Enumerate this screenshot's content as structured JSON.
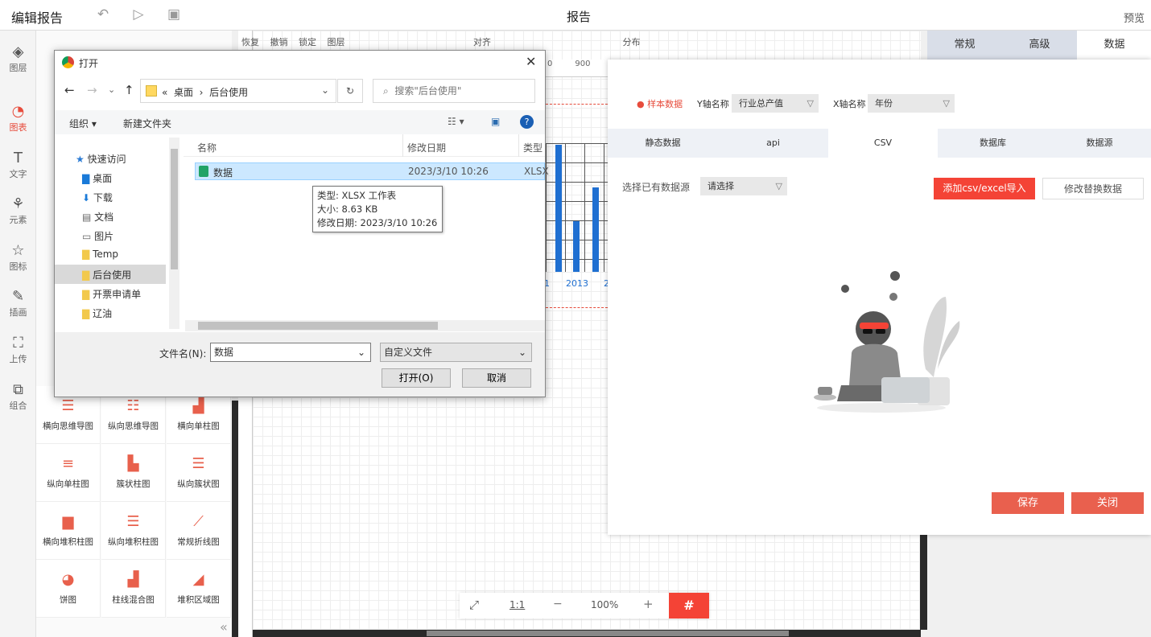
{
  "topbar": {
    "title": "编辑报告",
    "center_title": "报告",
    "preview": "预览"
  },
  "leftnav": [
    {
      "label": "图层",
      "icon": "layers-icon"
    },
    {
      "label": "图表",
      "icon": "chart-icon"
    },
    {
      "label": "文字",
      "icon": "text-icon"
    },
    {
      "label": "元素",
      "icon": "elements-icon"
    },
    {
      "label": "图标",
      "icon": "star-icon"
    },
    {
      "label": "插画",
      "icon": "palette-icon"
    },
    {
      "label": "上传",
      "icon": "upload-icon"
    },
    {
      "label": "组合",
      "icon": "group-icon"
    }
  ],
  "palette": {
    "tiles": [
      {
        "label": "横向思维导图",
        "icon": "mindmap-h-icon"
      },
      {
        "label": "纵向思维导图",
        "icon": "mindmap-v-icon"
      },
      {
        "label": "横向单柱图",
        "icon": "bar-h-icon"
      },
      {
        "label": "纵向单柱图",
        "icon": "bar-v-icon"
      },
      {
        "label": "簇状柱图",
        "icon": "cluster-bar-icon"
      },
      {
        "label": "纵向簇状图",
        "icon": "cluster-v-icon"
      },
      {
        "label": "横向堆积柱图",
        "icon": "stack-h-icon"
      },
      {
        "label": "纵向堆积柱图",
        "icon": "stack-v-icon"
      },
      {
        "label": "常规折线图",
        "icon": "line-icon"
      },
      {
        "label": "饼图",
        "icon": "pie-icon"
      },
      {
        "label": "柱线混合图",
        "icon": "combo-icon"
      },
      {
        "label": "堆积区域图",
        "icon": "area-icon"
      }
    ]
  },
  "toolbar": {
    "items": [
      "恢复",
      "撤销",
      "锁定",
      "图层",
      "对齐",
      "分布"
    ]
  },
  "right_tabs": [
    "常规",
    "高级",
    "数据"
  ],
  "data_panel": {
    "sample_label": "样本数据",
    "y_axis_label": "Y轴名称",
    "y_axis_value": "行业总产值",
    "x_axis_label": "X轴名称",
    "x_axis_value": "年份",
    "source_tabs": [
      "静态数据",
      "api",
      "CSV",
      "数据库",
      "数据源"
    ],
    "select_label": "选择已有数据源",
    "select_placeholder": "请选择",
    "import_button": "添加csv/excel导入",
    "replace_button": "修改替换数据",
    "save_button": "保存",
    "close_button": "关闭"
  },
  "canvas": {
    "ruler_labels": [
      "0",
      "900"
    ],
    "chart_year": "2013",
    "chart_year_prev": "1",
    "chart_year_next": "2"
  },
  "dialog": {
    "title": "打开",
    "path": [
      "«",
      "桌面",
      "›",
      "后台使用"
    ],
    "search_placeholder": "搜索\"后台使用\"",
    "organize": "组织",
    "new_folder": "新建文件夹",
    "tree": [
      {
        "label": "快速访问",
        "icon": "star-icon"
      },
      {
        "label": "桌面",
        "icon": "desktop-icon"
      },
      {
        "label": "下载",
        "icon": "download-icon"
      },
      {
        "label": "文档",
        "icon": "document-icon"
      },
      {
        "label": "图片",
        "icon": "picture-icon"
      },
      {
        "label": "Temp",
        "icon": "folder-icon"
      },
      {
        "label": "后台使用",
        "icon": "folder-icon"
      },
      {
        "label": "开票申请单",
        "icon": "folder-icon"
      },
      {
        "label": "辽油",
        "icon": "folder-icon"
      }
    ],
    "columns": [
      "名称",
      "修改日期",
      "类型"
    ],
    "files": [
      {
        "name": "数据",
        "date": "2023/3/10 10:26",
        "type": "XLSX"
      }
    ],
    "tooltip": [
      "类型: XLSX 工作表",
      "大小: 8.63 KB",
      "修改日期: 2023/3/10 10:26"
    ],
    "filename_label": "文件名(N):",
    "filename_value": "数据",
    "filetype_value": "自定义文件",
    "open_button": "打开(O)",
    "cancel_button": "取消"
  },
  "zoombar": {
    "fit": "⤢",
    "ratio": "1:1",
    "minus": "−",
    "zoom": "100%",
    "plus": "+",
    "grid": "#"
  },
  "colors": {
    "accent": "#f44336",
    "bar_blue": "#1f6fd1",
    "button_red": "#e9604e"
  }
}
